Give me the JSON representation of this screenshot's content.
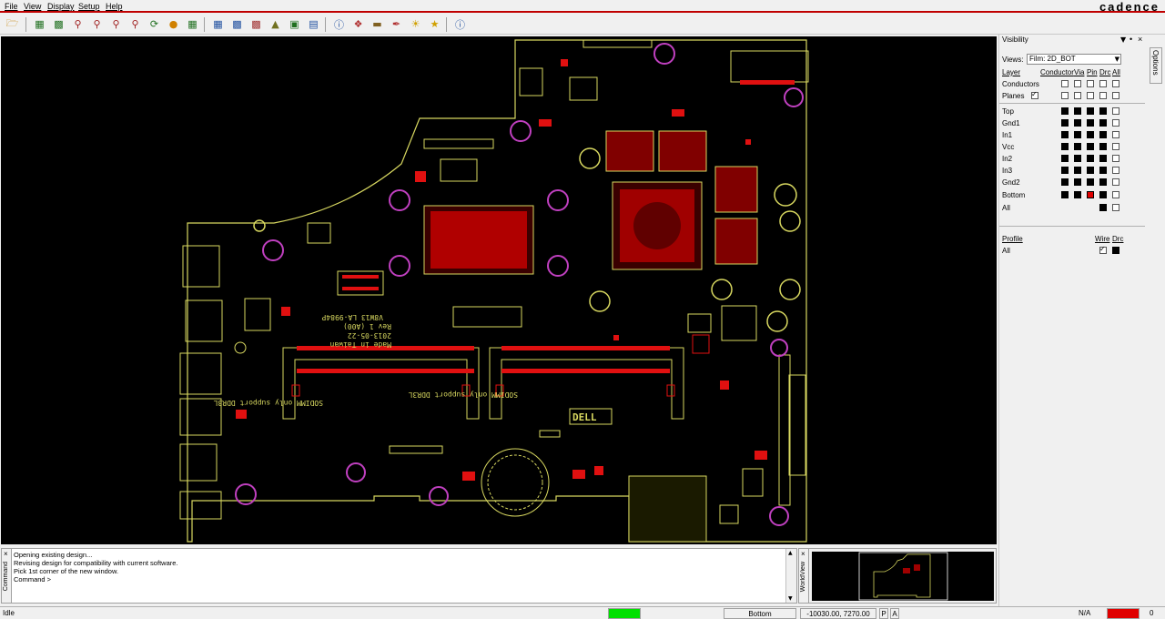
{
  "app": {
    "brand": "cadence"
  },
  "menu": {
    "items": [
      "File",
      "View",
      "Display",
      "Setup",
      "Help"
    ]
  },
  "toolbar": {
    "icons": [
      "open-icon",
      "zoom-fit-icon",
      "zoom-world-icon",
      "zoom-points-icon",
      "zoom-in-icon",
      "zoom-out-icon",
      "zoom-previous-icon",
      "redraw-icon",
      "refresh-icon",
      "grid-icon",
      "layers-icon",
      "colors-icon",
      "shadow-icon",
      "3d-view-icon",
      "stats-icon",
      "info-icon",
      "tag-icon",
      "measure-icon",
      "brush-icon",
      "sun-icon",
      "highlight-icon",
      "help-icon"
    ]
  },
  "visibility": {
    "title": "Visibility",
    "views_label": "Views:",
    "views_value": "Film: 2D_BOT",
    "layer_header": "Layer",
    "conductor_header": "Conductor",
    "via_header": "Via",
    "pin_header": "Pin",
    "drc_header": "Drc",
    "all_header": "All",
    "global_rows": [
      {
        "label": "Conductors"
      },
      {
        "label": "Planes"
      }
    ],
    "layers": [
      {
        "label": "Top"
      },
      {
        "label": "Gnd1"
      },
      {
        "label": "In1"
      },
      {
        "label": "Vcc"
      },
      {
        "label": "In2"
      },
      {
        "label": "In3"
      },
      {
        "label": "Gnd2"
      },
      {
        "label": "Bottom"
      },
      {
        "label": "All"
      }
    ],
    "profile_header": "Profile",
    "wire_header": "Wire",
    "profile_drc_header": "Drc",
    "profile_row": "All"
  },
  "options_tab": "Options",
  "command": {
    "side_label": "Command",
    "lines": [
      "Opening existing design...",
      "Revising design for compatibility with current software.",
      "Pick 1st corner of the new window.",
      "Command >"
    ]
  },
  "worldview": {
    "side_label": "WorldView"
  },
  "board": {
    "silk_lines": [
      "V8W13 LA-9984P",
      "Rev 1 (A00)",
      "2013-05-22",
      "Made in Taiwan"
    ],
    "dimm_labels": [
      "SODIMM only support DDR3L",
      "SODIMM only support DDR3L"
    ],
    "logo": "DELL"
  },
  "status": {
    "state": "Idle",
    "layer": "Bottom",
    "coords": "-10030.00, 7270.00",
    "p_button": "P",
    "a_button": "A",
    "na": "N/A",
    "count": "0",
    "colors": {
      "ready": "#00e000",
      "alert": "#e00000"
    }
  },
  "colors": {
    "board": "#d8d860",
    "copper": "#e01010",
    "via": "#c040c0",
    "background": "#000000"
  }
}
